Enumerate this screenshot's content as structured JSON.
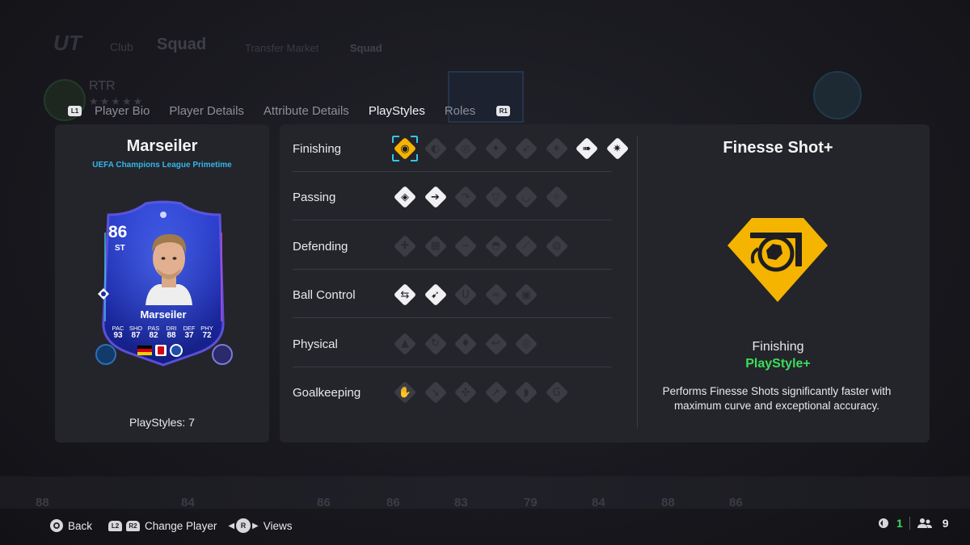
{
  "background": {
    "logo": "UT",
    "club": "Club",
    "squad": "Squad",
    "transfer_market": "Transfer Market",
    "squad_tab": "Squad",
    "manager": "RTR",
    "stars": "★★★★★",
    "bench_ratings": [
      "88",
      "84",
      "86",
      "86",
      "83",
      "79",
      "84",
      "88",
      "86"
    ]
  },
  "tabs": {
    "left_button": "L1",
    "right_button": "R1",
    "items": [
      {
        "label": "Player Bio",
        "active": false
      },
      {
        "label": "Player Details",
        "active": false
      },
      {
        "label": "Attribute Details",
        "active": false
      },
      {
        "label": "PlayStyles",
        "active": true
      },
      {
        "label": "Roles",
        "active": false
      }
    ]
  },
  "player": {
    "name": "Marseiler",
    "version": "UEFA Champions League Primetime",
    "rating": "86",
    "position": "ST",
    "card_name": "Marseiler",
    "stats": [
      {
        "key": "PAC",
        "value": "93"
      },
      {
        "key": "SHO",
        "value": "87"
      },
      {
        "key": "PAS",
        "value": "82"
      },
      {
        "key": "DRI",
        "value": "88"
      },
      {
        "key": "DEF",
        "value": "37"
      },
      {
        "key": "PHY",
        "value": "72"
      }
    ],
    "playstyles_count": "PlayStyles: 7"
  },
  "categories": [
    {
      "label": "Finishing",
      "icons": [
        {
          "name": "finesse-shot-plus-icon",
          "glyph": "◉",
          "state": "plus",
          "selected": true
        },
        {
          "name": "chip-shot-icon",
          "glyph": "◐",
          "state": "none"
        },
        {
          "name": "power-shot-icon",
          "glyph": "◎",
          "state": "none"
        },
        {
          "name": "dead-ball-icon",
          "glyph": "✦",
          "state": "none"
        },
        {
          "name": "precision-header-icon",
          "glyph": "➶",
          "state": "none"
        },
        {
          "name": "acrobatic-icon",
          "glyph": "✶",
          "state": "none"
        },
        {
          "name": "low-driven-shot-icon",
          "glyph": "➠",
          "state": "owned"
        },
        {
          "name": "game-changer-icon",
          "glyph": "✷",
          "state": "owned"
        }
      ]
    },
    {
      "label": "Passing",
      "icons": [
        {
          "name": "incisive-pass-icon",
          "glyph": "◈",
          "state": "owned"
        },
        {
          "name": "pinged-pass-icon",
          "glyph": "➔",
          "state": "owned"
        },
        {
          "name": "long-ball-pass-icon",
          "glyph": "↷",
          "state": "none"
        },
        {
          "name": "tiki-taka-icon",
          "glyph": "▽",
          "state": "none"
        },
        {
          "name": "whipped-pass-icon",
          "glyph": "◡",
          "state": "none"
        },
        {
          "name": "inventive-icon",
          "glyph": "✧",
          "state": "none"
        }
      ]
    },
    {
      "label": "Defending",
      "icons": [
        {
          "name": "jockey-icon",
          "glyph": "✚",
          "state": "none"
        },
        {
          "name": "block-icon",
          "glyph": "▦",
          "state": "none"
        },
        {
          "name": "intercept-icon",
          "glyph": "∽",
          "state": "none"
        },
        {
          "name": "anticipate-icon",
          "glyph": "◓",
          "state": "none"
        },
        {
          "name": "slide-tackle-icon",
          "glyph": "⟋",
          "state": "none"
        },
        {
          "name": "aerial-fortress-icon",
          "glyph": "◍",
          "state": "none"
        }
      ]
    },
    {
      "label": "Ball Control",
      "icons": [
        {
          "name": "technical-icon",
          "glyph": "⇆",
          "state": "owned"
        },
        {
          "name": "rapid-icon",
          "glyph": "➹",
          "state": "owned"
        },
        {
          "name": "first-touch-icon",
          "glyph": "U",
          "state": "none"
        },
        {
          "name": "trickster-icon",
          "glyph": "≈",
          "state": "none"
        },
        {
          "name": "press-proven-icon",
          "glyph": "▣",
          "state": "none"
        }
      ]
    },
    {
      "label": "Physical",
      "icons": [
        {
          "name": "quick-step-icon",
          "glyph": "▲",
          "state": "none"
        },
        {
          "name": "relentless-icon",
          "glyph": "↻",
          "state": "none"
        },
        {
          "name": "trivela-icon",
          "glyph": "♦",
          "state": "none"
        },
        {
          "name": "long-throw-icon",
          "glyph": "↩",
          "state": "none"
        },
        {
          "name": "bruiser-icon",
          "glyph": "◎",
          "state": "none"
        }
      ]
    },
    {
      "label": "Goalkeeping",
      "icons": [
        {
          "name": "far-throw-icon",
          "glyph": "✋",
          "state": "none"
        },
        {
          "name": "footwork-icon",
          "glyph": "↘",
          "state": "none"
        },
        {
          "name": "cross-claimer-icon",
          "glyph": "✣",
          "state": "none"
        },
        {
          "name": "rush-out-icon",
          "glyph": "➚",
          "state": "none"
        },
        {
          "name": "far-reach-icon",
          "glyph": "◗",
          "state": "none"
        },
        {
          "name": "deflector-icon",
          "glyph": "G",
          "state": "none"
        }
      ]
    }
  ],
  "detail": {
    "title": "Finesse Shot+",
    "category": "Finishing",
    "type": "PlayStyle+",
    "description": "Performs Finesse Shots significantly faster with maximum curve and exceptional accuracy.",
    "icon": "finesse-shot-plus-icon"
  },
  "footer": {
    "back": "Back",
    "l2": "L2",
    "r2": "R2",
    "change_player": "Change Player",
    "r_stick": "R",
    "views": "Views"
  },
  "status": {
    "online": "1",
    "friends": "9"
  },
  "colors": {
    "accent_cyan": "#33c6e8",
    "playstyle_plus": "#f4b400",
    "green": "#3ddc5a",
    "panel": "#24242b"
  }
}
